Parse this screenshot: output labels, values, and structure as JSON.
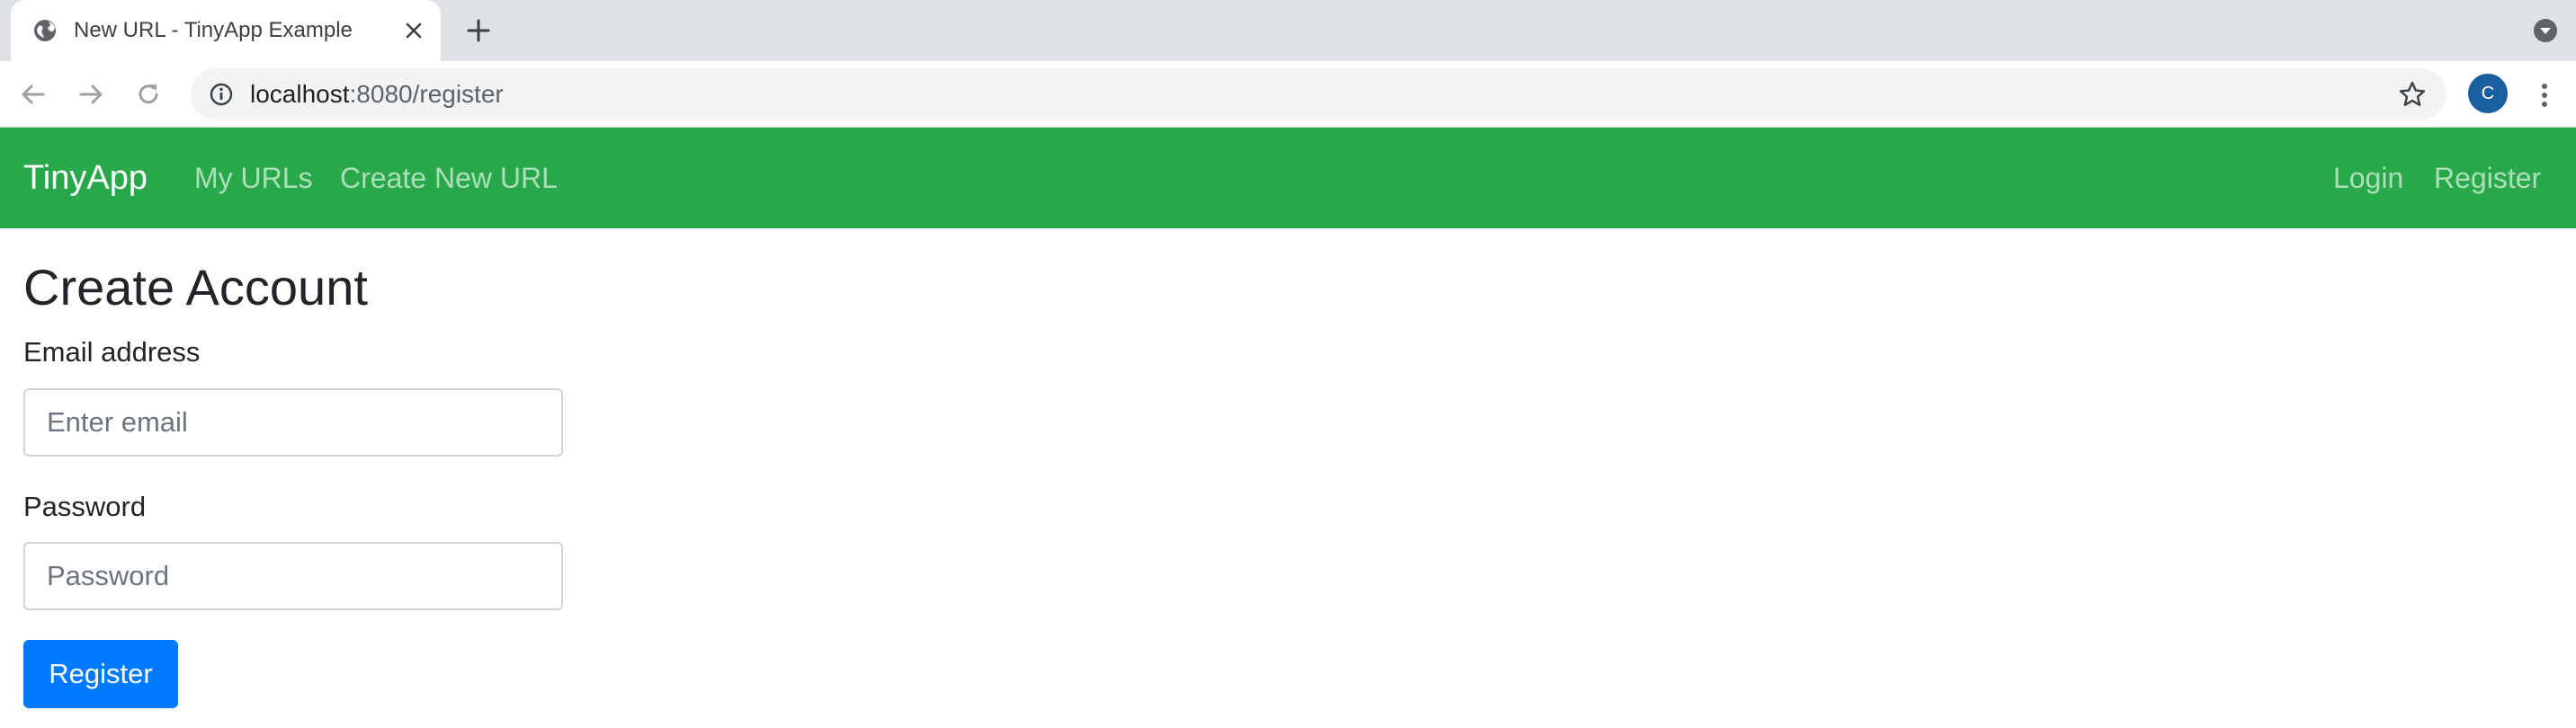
{
  "browser": {
    "tab_title": "New URL - TinyApp Example",
    "url_host": "localhost",
    "url_path": ":8080/register",
    "profile_initial": "C"
  },
  "navbar": {
    "brand": "TinyApp",
    "links": [
      "My URLs",
      "Create New URL"
    ],
    "right_links": [
      "Login",
      "Register"
    ],
    "color": "#28a84b"
  },
  "form": {
    "title": "Create Account",
    "email_label": "Email address",
    "email_placeholder": "Enter email",
    "email_value": "",
    "password_label": "Password",
    "password_placeholder": "Password",
    "password_value": "",
    "submit_label": "Register",
    "submit_color": "#007bff"
  },
  "icons": [
    "globe-icon",
    "close-icon",
    "plus-icon",
    "tab-search-icon",
    "back-arrow-icon",
    "forward-arrow-icon",
    "reload-icon",
    "info-icon",
    "star-icon",
    "kebab-menu-icon"
  ]
}
